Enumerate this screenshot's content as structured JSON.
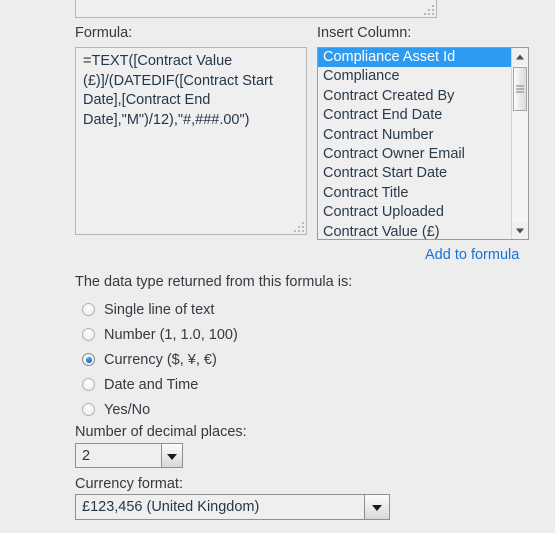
{
  "top_field": {
    "name": "description-textarea",
    "value": ""
  },
  "formula": {
    "label": "Formula:",
    "value": "=TEXT([Contract Value (£)]/(DATEDIF([Contract Start Date],[Contract End Date],\"M\")/12),\"#,###.00\")"
  },
  "insert_column": {
    "label": "Insert Column:",
    "selected": "Compliance Asset Id",
    "items": [
      "Compliance Asset Id",
      "Compliance",
      "Contract Created By",
      "Contract End Date",
      "Contract Number",
      "Contract Owner Email",
      "Contract Start Date",
      "Contract Title",
      "Contract Uploaded",
      "Contract Value (£)"
    ],
    "add_link": "Add to formula",
    "add_link_color": "#1573d8",
    "selection_color": "#2e9bf0"
  },
  "data_type": {
    "question": "The data type returned from this formula is:",
    "selected": "Currency ($, ¥, €)",
    "options": [
      "Single line of text",
      "Number (1, 1.0, 100)",
      "Currency ($, ¥, €)",
      "Date and Time",
      "Yes/No"
    ]
  },
  "decimal_places": {
    "label": "Number of decimal places:",
    "value": "2"
  },
  "currency_format": {
    "label": "Currency format:",
    "value": "£123,456 (United Kingdom)"
  }
}
